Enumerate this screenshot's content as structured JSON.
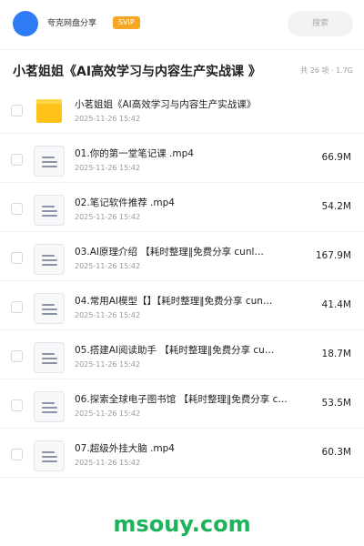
{
  "header": {
    "username": "夸克网盘分享",
    "badge": "SVIP",
    "search_placeholder": "搜索"
  },
  "share": {
    "title": "小茗姐姐《AI高效学习与内容生产实战课 》",
    "meta": "共 26 项 · 1.7G"
  },
  "items": [
    {
      "name": "小茗姐姐《AI高效学习与内容生产实战课》",
      "date": "2025-11-26 15:42",
      "size": "",
      "type": "folder"
    },
    {
      "name": "01.你的第一堂笔记课 .mp4",
      "date": "2025-11-26 15:42",
      "size": "66.9M",
      "type": "file"
    },
    {
      "name": "02.笔记软件推荐 .mp4",
      "date": "2025-11-26 15:42",
      "size": "54.2M",
      "type": "file"
    },
    {
      "name": "03.AI原理介绍 【耗时整理‖免费分享 cunl…",
      "date": "2025-11-26 15:42",
      "size": "167.9M",
      "type": "file"
    },
    {
      "name": "04.常用AI模型【】【耗时整理‖免费分享 cun…",
      "date": "2025-11-26 15:42",
      "size": "41.4M",
      "type": "file"
    },
    {
      "name": "05.搭建AI阅读助手 【耗时整理‖免费分享 cu…",
      "date": "2025-11-26 15:42",
      "size": "18.7M",
      "type": "file"
    },
    {
      "name": "06.探索全球电子图书馆 【耗时整理‖免费分享 c…",
      "date": "2025-11-26 15:42",
      "size": "53.5M",
      "type": "file"
    },
    {
      "name": "07.超级外挂大脑 .mp4",
      "date": "2025-11-26 15:42",
      "size": "60.3M",
      "type": "file"
    }
  ],
  "watermark": "msouy.com"
}
